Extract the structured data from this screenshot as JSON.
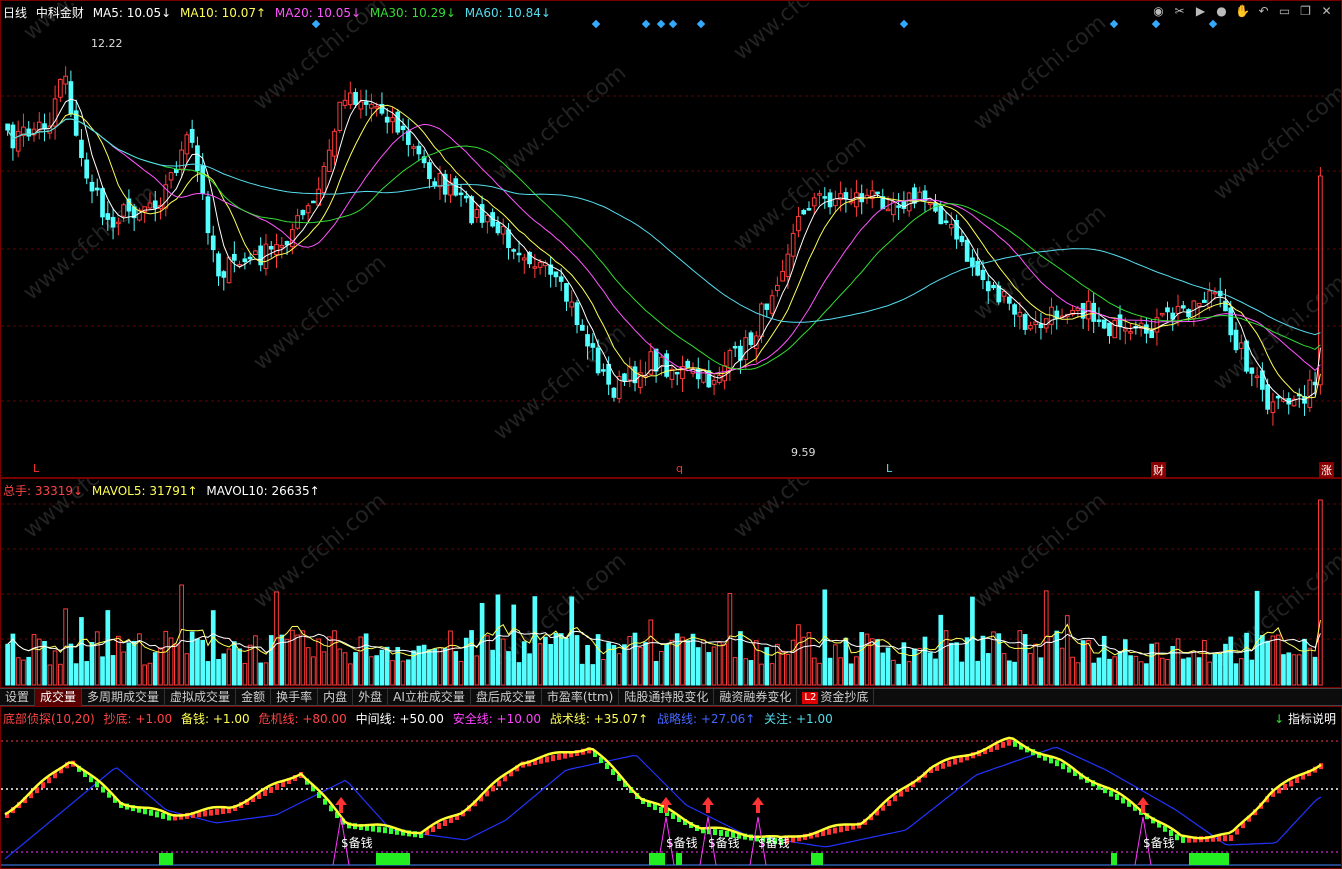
{
  "price_header": {
    "period": "日线",
    "stock": "中科金财",
    "ma5_label": "MA5: 10.05↓",
    "ma10_label": "MA10: 10.07↑",
    "ma20_label": "MA20: 10.05↓",
    "ma30_label": "MA30: 10.29↓",
    "ma60_label": "MA60: 10.84↓"
  },
  "price_marks": {
    "high": "12.22",
    "low": "9.59",
    "m1": "L",
    "m2": "q",
    "m3": "L",
    "m4": "财",
    "m5": "涨"
  },
  "vol_header": {
    "total": "总手: 33319↓",
    "mavol5": "MAVOL5: 31791↑",
    "mavol10": "MAVOL10: 26635↑"
  },
  "tabs": [
    "设置",
    "成交量",
    "多周期成交量",
    "虚拟成交量",
    "金额",
    "换手率",
    "内盘",
    "外盘",
    "AI立桩成交量",
    "盘后成交量",
    "市盈率(ttm)",
    "陆股通持股变化",
    "融资融券变化",
    "资金抄底"
  ],
  "tab_badge": "L2",
  "ind_header": {
    "name": "底部侦探(10,20)",
    "chaodi": "抄底: +1.00",
    "beiqian": "备钱: +1.00",
    "weiji": "危机线: +80.00",
    "zhongjian": "中间线: +50.00",
    "anquan": "安全线: +10.00",
    "zhanshu": "战术线: +35.07↑",
    "zhanlue": "战略线: +27.06↑",
    "guanzhu": "关注: +1.00"
  },
  "help_label": "指标说明",
  "signal_label": "$备钱",
  "watermark": "www.cfchi.com",
  "toolbar_icons": [
    "eye-icon",
    "scissors-icon",
    "play-icon",
    "record-icon",
    "hand-icon",
    "undo-icon",
    "minimize-icon",
    "restore-icon",
    "close-icon"
  ],
  "colors": {
    "up": "#ff3b3b",
    "down": "#54ffff",
    "ma5": "#ffffff",
    "ma10": "#ffff55",
    "ma20": "#ff55ff",
    "ma30": "#33dd33",
    "ma60": "#55ddee"
  }
}
